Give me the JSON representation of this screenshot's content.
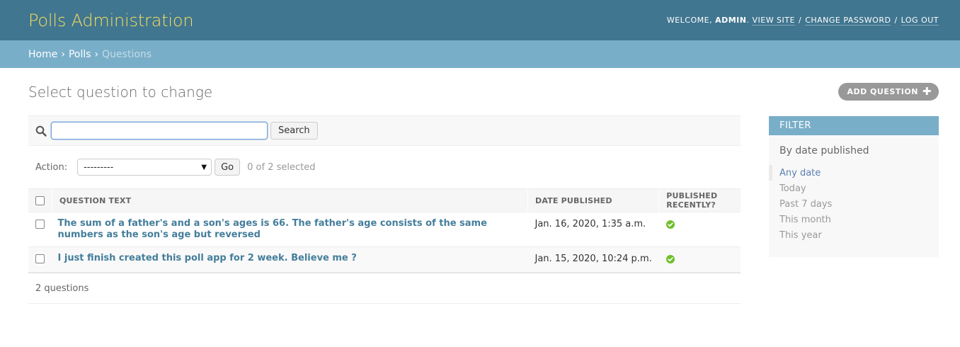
{
  "header": {
    "branding": "Polls Administration",
    "welcome": "Welcome,",
    "username": "admin",
    "view_site": "View site",
    "change_password": "Change password",
    "log_out": "Log out"
  },
  "breadcrumbs": {
    "home": "Home",
    "app": "Polls",
    "current": "Questions"
  },
  "page": {
    "title": "Select question to change",
    "add_button": "Add question"
  },
  "search": {
    "value": "",
    "button": "Search"
  },
  "actions": {
    "label": "Action:",
    "selected_option": "---------",
    "go": "Go",
    "selected_count": "0 of 2 selected"
  },
  "table": {
    "columns": [
      "Question text",
      "Date published",
      "Published recently?"
    ],
    "rows": [
      {
        "question": "The sum of a father's and a son's ages is 66. The father's age consists of the same numbers as the son's age but reversed",
        "date": "Jan. 16, 2020, 1:35 a.m.",
        "published_recently": true
      },
      {
        "question": "I just finish created this poll app for 2 week. Believe me ?",
        "date": "Jan. 15, 2020, 10:24 p.m.",
        "published_recently": true
      }
    ]
  },
  "paginator": {
    "text": "2 questions"
  },
  "filter": {
    "heading": "Filter",
    "title": "By date published",
    "options": [
      "Any date",
      "Today",
      "Past 7 days",
      "This month",
      "This year"
    ],
    "selected": "Any date"
  },
  "colors": {
    "header_bg": "#417690",
    "branding": "#f5dd5d",
    "breadcrumbs_bg": "#79aec8",
    "link": "#447e9b",
    "ok_green": "#70bf2b"
  }
}
